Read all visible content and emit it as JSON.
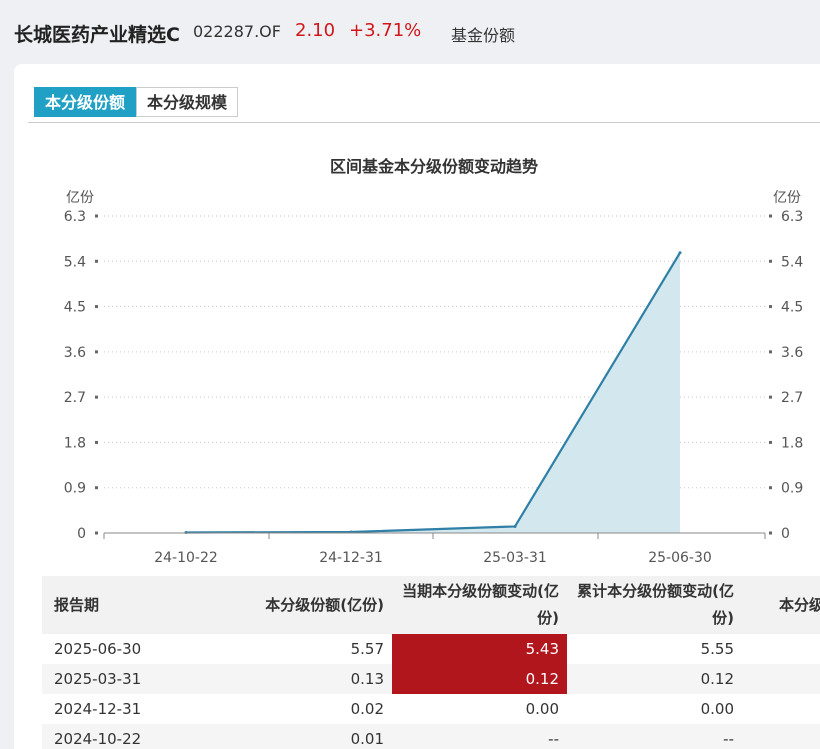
{
  "header": {
    "fund_name": "长城医药产业精选C",
    "fund_code": "022287.OF",
    "price": "2.10",
    "change": "+3.71%",
    "tab": "基金份额"
  },
  "tabs": [
    {
      "label": "本分级份额",
      "active": true
    },
    {
      "label": "本分级规模",
      "active": false
    }
  ],
  "colors": {
    "accent": "#1fa0c4",
    "up": "#d0181b",
    "highlight": "#b1161c",
    "line": "#2f7fa6",
    "area": "#d3e7ee"
  },
  "chart_data": {
    "type": "area",
    "title": "区间基金本分级份额变动趋势",
    "ylabel_left": "亿份",
    "ylabel_right": "亿份",
    "yticks": [
      "6.3",
      "5.4",
      "4.5",
      "3.6",
      "2.7",
      "1.8",
      "0.9",
      "0"
    ],
    "ylim": [
      0,
      6.3
    ],
    "xticks": [
      "24-10-22",
      "24-12-31",
      "25-03-31",
      "25-06-30"
    ],
    "x": [
      "24-10-22",
      "24-12-31",
      "25-03-31",
      "25-06-30"
    ],
    "series": [
      {
        "values": [
          0.01,
          0.02,
          0.13,
          5.57
        ]
      }
    ],
    "grid": true
  },
  "table": {
    "headers": [
      "报告期",
      "本分级份额(亿份)",
      "当期本分级份额变动(亿份)",
      "累计本分级份额变动(亿份)",
      "本分级"
    ],
    "rows": [
      [
        "2025-06-30",
        "5.57",
        "5.43",
        "5.55",
        ""
      ],
      [
        "2025-03-31",
        "0.13",
        "0.12",
        "0.12",
        ""
      ],
      [
        "2024-12-31",
        "0.02",
        "0.00",
        "0.00",
        ""
      ],
      [
        "2024-10-22",
        "0.01",
        "--",
        "--",
        ""
      ]
    ]
  }
}
